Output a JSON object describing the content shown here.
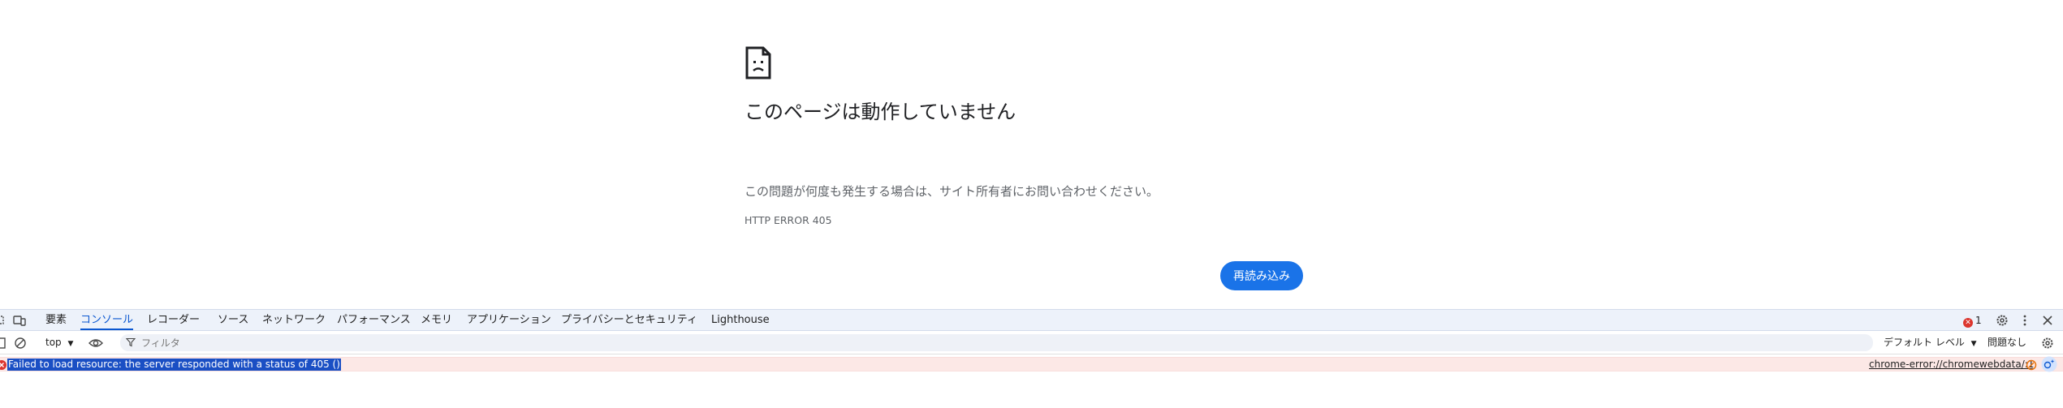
{
  "error_page": {
    "title": "このページは動作していません",
    "message": "この問題が何度も発生する場合は、サイト所有者にお問い合わせください。",
    "code": "HTTP ERROR 405",
    "reload_label": "再読み込み",
    "icon": "sad-page-icon"
  },
  "devtools": {
    "tabs": [
      "要素",
      "コンソール",
      "レコーダー",
      "ソース",
      "ネットワーク",
      "パフォーマンス",
      "メモリ",
      "アプリケーション",
      "プライバシーとセキュリティ",
      "Lighthouse"
    ],
    "active_tab": "コンソール",
    "error_count": "1",
    "context": "top",
    "filter_placeholder": "フィルタ",
    "level_label": "デフォルト レベル",
    "issues_label": "問題なし",
    "console": {
      "message": "Failed to load resource: the server responded with a status of 405 ()",
      "source": "chrome-error://chromewebdata/:1"
    }
  },
  "colors": {
    "accent": "#1a73e8",
    "devtools_active": "#0b57d0",
    "error_red": "#dc362e",
    "error_row_bg": "#fce8e6",
    "selection": "#1a4fc4"
  }
}
